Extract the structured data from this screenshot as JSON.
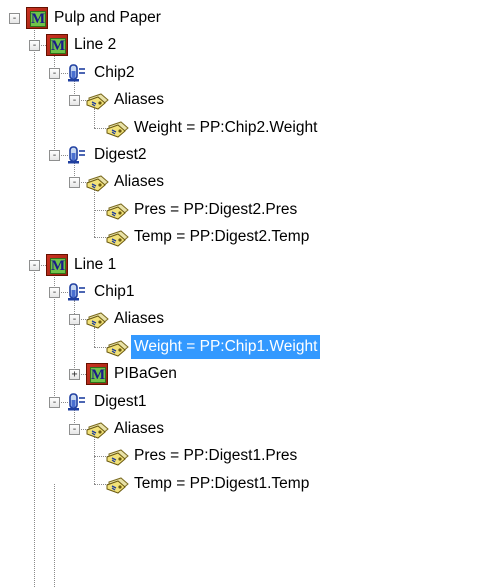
{
  "tree": {
    "nodes": [
      {
        "label": "Pulp and Paper",
        "icon": "module-icon",
        "toggle": "-",
        "level": 0
      },
      {
        "label": "Line 2",
        "icon": "module-icon",
        "toggle": "-",
        "level": 1
      },
      {
        "label": "Chip2",
        "icon": "unit-icon",
        "toggle": "-",
        "level": 2
      },
      {
        "label": "Aliases",
        "icon": "alias-tag-icon",
        "toggle": "-",
        "level": 3
      },
      {
        "label": "Weight = PP:Chip2.Weight",
        "icon": "alias-tag-icon",
        "toggle": "",
        "level": 4
      },
      {
        "label": "Digest2",
        "icon": "unit-icon",
        "toggle": "-",
        "level": 2
      },
      {
        "label": "Aliases",
        "icon": "alias-tag-icon",
        "toggle": "-",
        "level": 3
      },
      {
        "label": "Pres = PP:Digest2.Pres",
        "icon": "alias-tag-icon",
        "toggle": "",
        "level": 4
      },
      {
        "label": "Temp = PP:Digest2.Temp",
        "icon": "alias-tag-icon",
        "toggle": "",
        "level": 4
      },
      {
        "label": "Line 1",
        "icon": "module-icon",
        "toggle": "-",
        "level": 1
      },
      {
        "label": "Chip1",
        "icon": "unit-icon",
        "toggle": "-",
        "level": 2
      },
      {
        "label": "Aliases",
        "icon": "alias-tag-icon",
        "toggle": "-",
        "level": 3
      },
      {
        "label": "Weight = PP:Chip1.Weight",
        "icon": "alias-tag-icon",
        "toggle": "",
        "level": 4,
        "selected": true
      },
      {
        "label": "PIBaGen",
        "icon": "module-icon",
        "toggle": "+",
        "level": 3
      },
      {
        "label": "Digest1",
        "icon": "unit-icon",
        "toggle": "-",
        "level": 2
      },
      {
        "label": "Aliases",
        "icon": "alias-tag-icon",
        "toggle": "-",
        "level": 3
      },
      {
        "label": "Pres = PP:Digest1.Pres",
        "icon": "alias-tag-icon",
        "toggle": "",
        "level": 4
      },
      {
        "label": "Temp = PP:Digest1.Temp",
        "icon": "alias-tag-icon",
        "toggle": "",
        "level": 4
      }
    ]
  },
  "colors": {
    "selection": "#3399ff",
    "selection_text": "#ffffff",
    "tree_line": "#8a8a8a"
  }
}
